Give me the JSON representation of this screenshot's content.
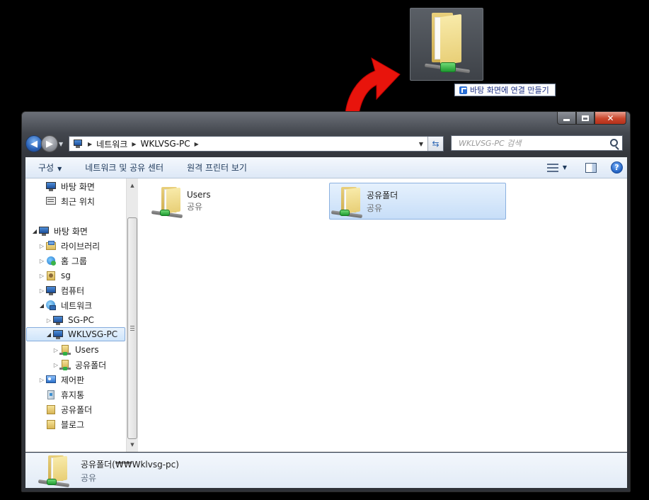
{
  "drag": {
    "tooltip": "바탕 화면에 연결 만들기"
  },
  "window": {
    "address": [
      "네트워크",
      "WKLVSG-PC"
    ],
    "search_placeholder": "WKLVSG-PC 검색"
  },
  "toolbar": {
    "organize": "구성",
    "network_sharing": "네트워크 및 공유 센터",
    "remote_printers": "원격 프린터 보기"
  },
  "nav": {
    "favorites": [
      {
        "label": "바탕 화면",
        "icon": "desktop-icon"
      },
      {
        "label": "최근 위치",
        "icon": "recent-places-icon"
      }
    ],
    "tree": [
      {
        "label": "바탕 화면",
        "icon": "desktop-icon",
        "state": "open",
        "level": 0
      },
      {
        "label": "라이브러리",
        "icon": "library-icon",
        "state": "closed",
        "level": 1
      },
      {
        "label": "홈 그룹",
        "icon": "homegroup-icon",
        "state": "closed",
        "level": 1
      },
      {
        "label": "sg",
        "icon": "user-folder-icon",
        "state": "closed",
        "level": 1
      },
      {
        "label": "컴퓨터",
        "icon": "computer-icon",
        "state": "closed",
        "level": 1
      },
      {
        "label": "네트워크",
        "icon": "network-icon",
        "state": "open",
        "level": 1
      },
      {
        "label": "SG-PC",
        "icon": "computer-icon",
        "state": "closed",
        "level": 2
      },
      {
        "label": "WKLVSG-PC",
        "icon": "computer-icon",
        "state": "open",
        "level": 2
      },
      {
        "label": "Users",
        "icon": "shared-folder-icon",
        "state": "closed",
        "level": 3
      },
      {
        "label": "공유폴더",
        "icon": "shared-folder-icon",
        "state": "closed",
        "level": 3
      },
      {
        "label": "제어판",
        "icon": "control-panel-icon",
        "state": "closed",
        "level": 1
      },
      {
        "label": "휴지통",
        "icon": "recycle-bin-icon",
        "state": "none",
        "level": 1
      },
      {
        "label": "공유폴더",
        "icon": "folder-icon",
        "state": "none",
        "level": 1
      },
      {
        "label": "블로그",
        "icon": "folder-icon",
        "state": "none",
        "level": 1
      }
    ]
  },
  "files": [
    {
      "name": "Users",
      "sub": "공유",
      "selected": false
    },
    {
      "name": "공유폴더",
      "sub": "공유",
      "selected": true
    }
  ],
  "details": {
    "name": "공유폴더(₩₩Wklvsg-pc)",
    "sub": "공유"
  },
  "colors": {
    "accent_red": "#e8140c",
    "selection": "#cfe4fa"
  }
}
